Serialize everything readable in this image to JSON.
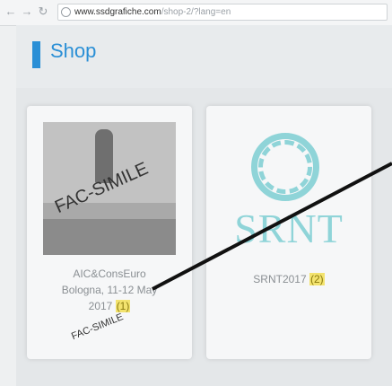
{
  "browser": {
    "url_domain": "www.ssdgrafiche.com",
    "url_path": "/shop-2/?lang=en"
  },
  "header": {
    "title": "Shop",
    "accent_color": "#2a8fd6"
  },
  "products": [
    {
      "caption_line1": "AIC&ConsEuro",
      "caption_line2": "Bologna, 11-12 May",
      "caption_line3": "2017",
      "count": "(1)"
    },
    {
      "logo_text": "SRNT",
      "caption_line1": "SRNT2017",
      "count": "(2)",
      "logo_color": "#8fd4d8"
    }
  ],
  "stamps": {
    "large": "FAC-SIMILE",
    "small": "FAC-SIMILE"
  }
}
